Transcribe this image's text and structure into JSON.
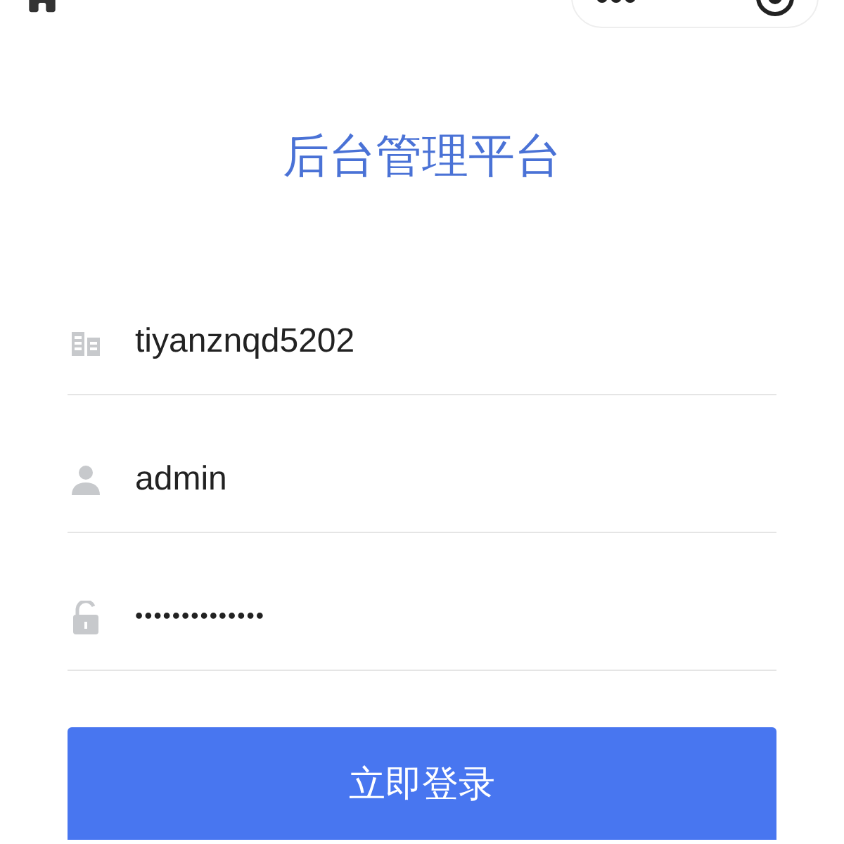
{
  "title": "后台管理平台",
  "fields": [
    {
      "kind": "company",
      "value": "tiyanznqd5202"
    },
    {
      "kind": "user",
      "value": "admin"
    },
    {
      "kind": "password",
      "value": "••••••••••••••"
    }
  ],
  "login_button": "立即登录"
}
